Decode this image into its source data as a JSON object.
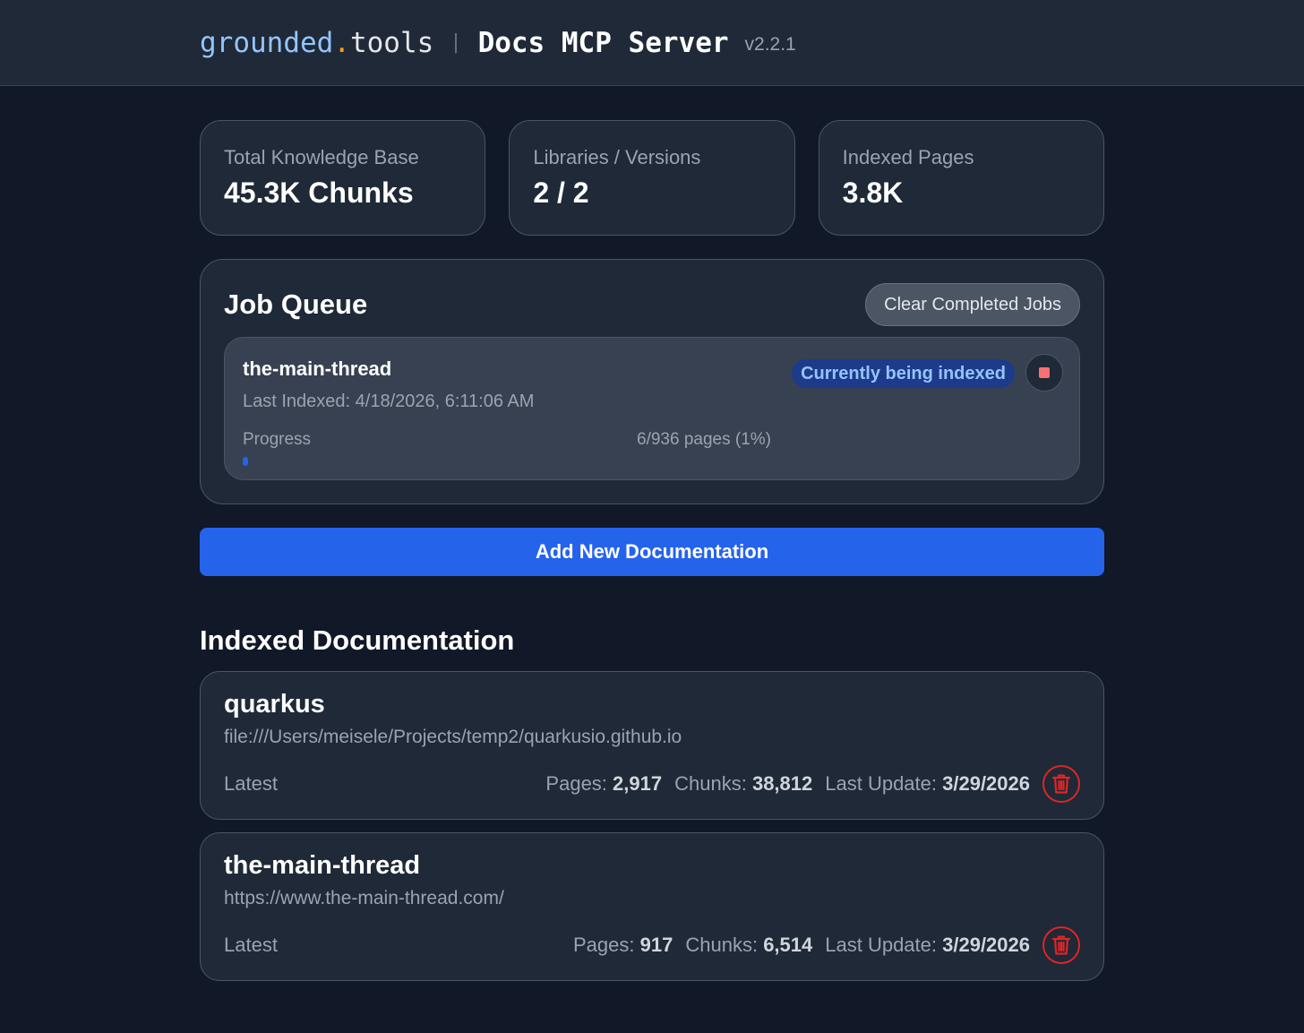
{
  "header": {
    "brand_part1": "grounded",
    "brand_dot": ".",
    "brand_part2": "tools",
    "separator": "|",
    "title": "Docs MCP Server",
    "version": "v2.2.1"
  },
  "stats": [
    {
      "label": "Total Knowledge Base",
      "value": "45.3K Chunks"
    },
    {
      "label": "Libraries / Versions",
      "value": "2 / 2"
    },
    {
      "label": "Indexed Pages",
      "value": "3.8K"
    }
  ],
  "queue": {
    "title": "Job Queue",
    "clear_label": "Clear Completed Jobs",
    "job": {
      "name": "the-main-thread",
      "last_indexed": "Last Indexed: 4/18/2026, 6:11:06 AM",
      "status": "Currently being indexed",
      "progress_label": "Progress",
      "progress_text": "6/936 pages (1%)",
      "progress_fraction": 0.01
    }
  },
  "add_label": "Add New Documentation",
  "indexed": {
    "title": "Indexed Documentation",
    "docs": [
      {
        "name": "quarkus",
        "url": "file:///Users/meisele/Projects/temp2/quarkusio.github.io",
        "version": "Latest",
        "pages_label": "Pages:",
        "pages": "2,917",
        "chunks_label": "Chunks:",
        "chunks": "38,812",
        "update_label": "Last Update:",
        "update": "3/29/2026"
      },
      {
        "name": "the-main-thread",
        "url": "https://www.the-main-thread.com/",
        "version": "Latest",
        "pages_label": "Pages:",
        "pages": "917",
        "chunks_label": "Chunks:",
        "chunks": "6,514",
        "update_label": "Last Update:",
        "update": "3/29/2026"
      }
    ]
  },
  "colors": {
    "background": "#111827",
    "card": "#1f2937",
    "accent": "#2563eb",
    "danger": "#dc2626"
  }
}
